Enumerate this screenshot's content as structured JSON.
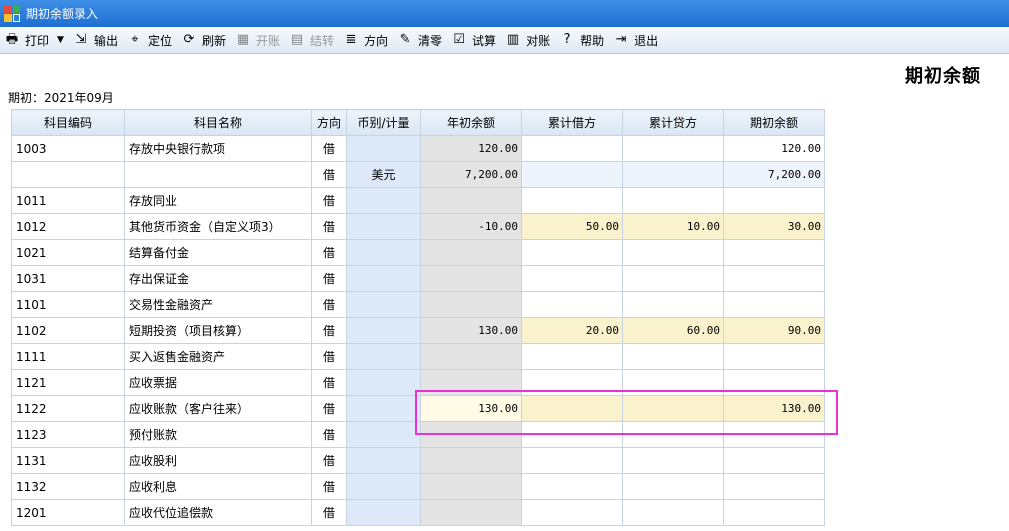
{
  "window": {
    "title": "期初余额录入"
  },
  "toolbar": {
    "items": [
      {
        "label": "打印",
        "icon": "printer-icon",
        "glyph": "🖶",
        "disabled": false,
        "dropdown": true
      },
      {
        "label": "输出",
        "icon": "export-icon",
        "glyph": "⇲",
        "disabled": false
      },
      {
        "label": "定位",
        "icon": "locate-icon",
        "glyph": "⌖",
        "disabled": false
      },
      {
        "label": "刷新",
        "icon": "refresh-icon",
        "glyph": "⟳",
        "disabled": false
      },
      {
        "label": "开账",
        "icon": "open-books-icon",
        "glyph": "▦",
        "disabled": true
      },
      {
        "label": "结转",
        "icon": "carry-forward-icon",
        "glyph": "▤",
        "disabled": true
      },
      {
        "label": "方向",
        "icon": "direction-icon",
        "glyph": "≣",
        "disabled": false
      },
      {
        "label": "清零",
        "icon": "broom-icon",
        "glyph": "✎",
        "disabled": false
      },
      {
        "label": "试算",
        "icon": "trial-balance-icon",
        "glyph": "☑",
        "disabled": false
      },
      {
        "label": "对账",
        "icon": "reconcile-icon",
        "glyph": "▥",
        "disabled": false
      },
      {
        "label": "帮助",
        "icon": "help-icon",
        "glyph": "?",
        "disabled": false
      },
      {
        "label": "退出",
        "icon": "exit-icon",
        "glyph": "⇥",
        "disabled": false
      }
    ]
  },
  "sheet": {
    "title": "期初余额",
    "period_label": "期初：2021年09月"
  },
  "table": {
    "columns": [
      "科目编码",
      "科目名称",
      "方向",
      "币别/计量",
      "年初余额",
      "累计借方",
      "累计贷方",
      "期初余额"
    ],
    "rows": [
      {
        "code": "1003",
        "name": "存放中央银行款项",
        "dir": "借",
        "cur": "",
        "init": "120.00",
        "debit": "",
        "credit": "",
        "bal": "120.00",
        "yellow": false
      },
      {
        "code": "",
        "name": "",
        "dir": "借",
        "cur": "美元",
        "init": "7,200.00",
        "debit": "",
        "credit": "",
        "bal": "7,200.00",
        "yellow": false,
        "lightblue": true
      },
      {
        "code": "1011",
        "name": "存放同业",
        "dir": "借",
        "cur": "",
        "init": "",
        "debit": "",
        "credit": "",
        "bal": "",
        "yellow": false
      },
      {
        "code": "1012",
        "name": "其他货币资金（自定义项3）",
        "dir": "借",
        "cur": "",
        "init": "-10.00",
        "debit": "50.00",
        "credit": "10.00",
        "bal": "30.00",
        "yellow": true
      },
      {
        "code": "1021",
        "name": "结算备付金",
        "dir": "借",
        "cur": "",
        "init": "",
        "debit": "",
        "credit": "",
        "bal": "",
        "yellow": false
      },
      {
        "code": "1031",
        "name": "存出保证金",
        "dir": "借",
        "cur": "",
        "init": "",
        "debit": "",
        "credit": "",
        "bal": "",
        "yellow": false
      },
      {
        "code": "1101",
        "name": "交易性金融资产",
        "dir": "借",
        "cur": "",
        "init": "",
        "debit": "",
        "credit": "",
        "bal": "",
        "yellow": false
      },
      {
        "code": "1102",
        "name": "短期投资（项目核算）",
        "dir": "借",
        "cur": "",
        "init": "130.00",
        "debit": "20.00",
        "credit": "60.00",
        "bal": "90.00",
        "yellow": true
      },
      {
        "code": "1111",
        "name": "买入返售金融资产",
        "dir": "借",
        "cur": "",
        "init": "",
        "debit": "",
        "credit": "",
        "bal": "",
        "yellow": false
      },
      {
        "code": "1121",
        "name": "应收票据",
        "dir": "借",
        "cur": "",
        "init": "",
        "debit": "",
        "credit": "",
        "bal": "",
        "yellow": false
      },
      {
        "code": "1122",
        "name": "应收账款（客户往来）",
        "dir": "借",
        "cur": "",
        "init": "130.00",
        "debit": "",
        "credit": "",
        "bal": "130.00",
        "yellow": true,
        "editing": true
      },
      {
        "code": "1123",
        "name": "预付账款",
        "dir": "借",
        "cur": "",
        "init": "",
        "debit": "",
        "credit": "",
        "bal": "",
        "yellow": false
      },
      {
        "code": "1131",
        "name": "应收股利",
        "dir": "借",
        "cur": "",
        "init": "",
        "debit": "",
        "credit": "",
        "bal": "",
        "yellow": false
      },
      {
        "code": "1132",
        "name": "应收利息",
        "dir": "借",
        "cur": "",
        "init": "",
        "debit": "",
        "credit": "",
        "bal": "",
        "yellow": false
      },
      {
        "code": "1201",
        "name": "应收代位追偿款",
        "dir": "借",
        "cur": "",
        "init": "",
        "debit": "",
        "credit": "",
        "bal": "",
        "yellow": false
      }
    ]
  },
  "colors": {
    "highlight": "#e832d6",
    "yellow_cell": "#f9f2cc",
    "currency_col": "#dde9f9",
    "init_col": "#e4e4e4"
  }
}
